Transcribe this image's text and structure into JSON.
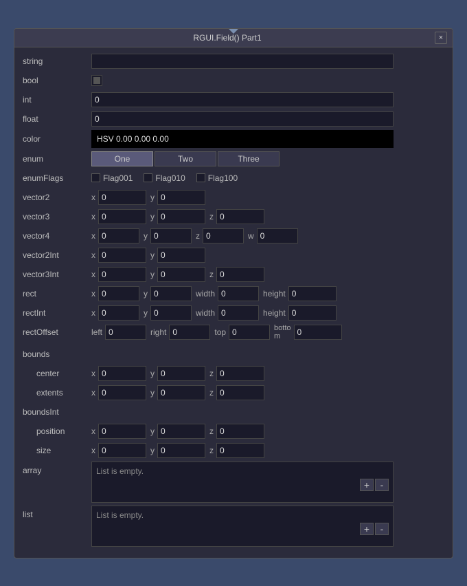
{
  "window": {
    "title": "RGUI.Field() Part1",
    "close_label": "×"
  },
  "fields": {
    "string_label": "string",
    "bool_label": "bool",
    "int_label": "int",
    "float_label": "float",
    "color_label": "color",
    "color_value": "HSV 0.00 0.00 0.00",
    "enum_label": "enum",
    "enum_buttons": [
      "One",
      "Two",
      "Three"
    ],
    "enumFlags_label": "enumFlags",
    "flags": [
      "Flag001",
      "Flag010",
      "Flag100"
    ],
    "vector2_label": "vector2",
    "vector3_label": "vector3",
    "vector4_label": "vector4",
    "vector2Int_label": "vector2Int",
    "vector3Int_label": "vector3Int",
    "rect_label": "rect",
    "rectInt_label": "rectInt",
    "rectOffset_label": "rectOffset",
    "bounds_label": "bounds",
    "bounds_center_label": "center",
    "bounds_extents_label": "extents",
    "boundsInt_label": "boundsInt",
    "boundsInt_position_label": "position",
    "boundsInt_size_label": "size",
    "array_label": "array",
    "list_label": "list",
    "list_empty_text": "List is empty.",
    "array_empty_text": "List is empty.",
    "plus_label": "+",
    "minus_label": "-",
    "zero": "0",
    "x": "x",
    "y": "y",
    "z": "z",
    "w": "w",
    "width_label": "width",
    "height_label": "height",
    "left_label": "left",
    "right_label": "right",
    "top_label": "top",
    "bottom_label": "botto m"
  }
}
